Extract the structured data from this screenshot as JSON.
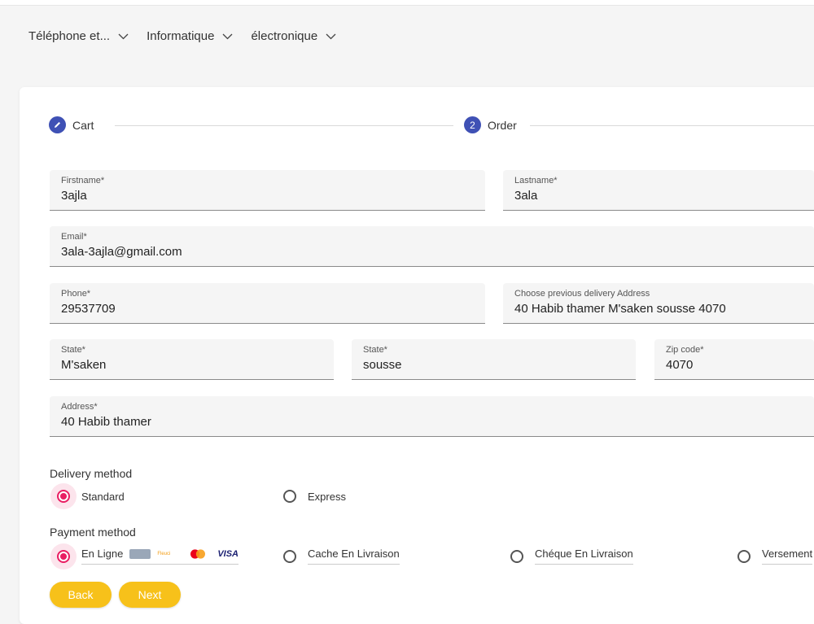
{
  "nav": [
    {
      "label": "Téléphone et..."
    },
    {
      "label": "Informatique"
    },
    {
      "label": "électronique"
    }
  ],
  "stepper": {
    "steps": [
      {
        "label": "Cart",
        "icon": "pencil-icon",
        "number": ""
      },
      {
        "label": "Order",
        "icon": "",
        "number": "2"
      }
    ]
  },
  "form": {
    "firstname": {
      "label": "Firstname*",
      "value": "3ajla"
    },
    "lastname": {
      "label": "Lastname*",
      "value": "3ala"
    },
    "email": {
      "label": "Email*",
      "value": "3ala-3ajla@gmail.com"
    },
    "phone": {
      "label": "Phone*",
      "value": "29537709"
    },
    "previous_address": {
      "label": "Choose previous delivery Address",
      "value": "40 Habib thamer M'saken sousse 4070"
    },
    "state1": {
      "label": "State*",
      "value": "M'saken"
    },
    "state2": {
      "label": "State*",
      "value": "sousse"
    },
    "zip": {
      "label": "Zip code*",
      "value": "4070"
    },
    "address": {
      "label": "Address*",
      "value": "40 Habib thamer"
    }
  },
  "delivery": {
    "title": "Delivery method",
    "options": [
      {
        "label": "Standard",
        "checked": true
      },
      {
        "label": "Express",
        "checked": false
      }
    ]
  },
  "payment": {
    "title": "Payment method",
    "options": [
      {
        "label": "En Ligne",
        "checked": true
      },
      {
        "label": "Cache En Livraison",
        "checked": false
      },
      {
        "label": "Chéque En Livraison",
        "checked": false
      },
      {
        "label": "Versement",
        "checked": false
      }
    ],
    "card_logos": [
      {
        "label": "",
        "color": "#9aa7b8"
      },
      {
        "label": "Fleuci",
        "color": "#f39c12"
      },
      {
        "label": "MasterCard",
        "color": "#eb001b"
      },
      {
        "label": "VISA",
        "color": "#1a1f71"
      }
    ]
  },
  "buttons": {
    "back": "Back",
    "next": "Next"
  },
  "colors": {
    "accent": "#3f51b5",
    "radio": "#e91e63",
    "button": "#f7c11a"
  }
}
